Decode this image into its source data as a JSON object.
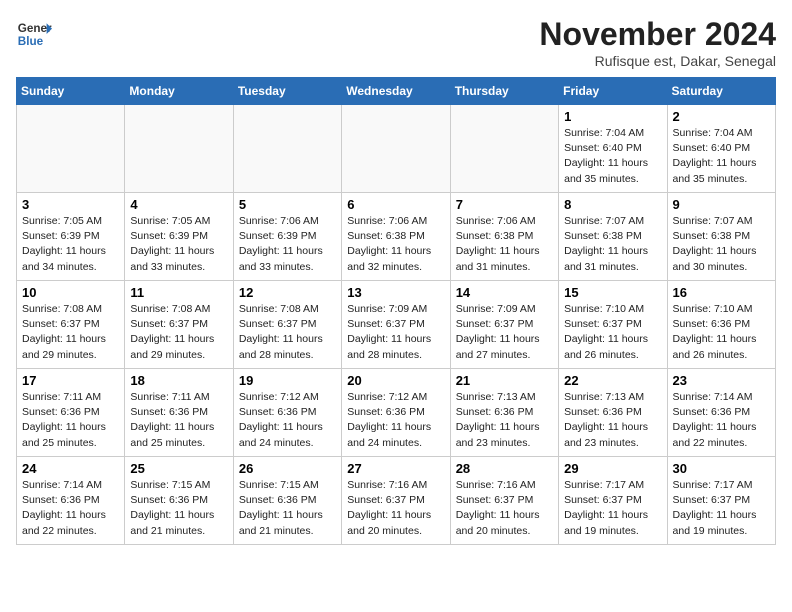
{
  "header": {
    "logo_line1": "General",
    "logo_line2": "Blue",
    "month_title": "November 2024",
    "location": "Rufisque est, Dakar, Senegal"
  },
  "weekdays": [
    "Sunday",
    "Monday",
    "Tuesday",
    "Wednesday",
    "Thursday",
    "Friday",
    "Saturday"
  ],
  "weeks": [
    [
      {
        "day": "",
        "info": ""
      },
      {
        "day": "",
        "info": ""
      },
      {
        "day": "",
        "info": ""
      },
      {
        "day": "",
        "info": ""
      },
      {
        "day": "",
        "info": ""
      },
      {
        "day": "1",
        "info": "Sunrise: 7:04 AM\nSunset: 6:40 PM\nDaylight: 11 hours\nand 35 minutes."
      },
      {
        "day": "2",
        "info": "Sunrise: 7:04 AM\nSunset: 6:40 PM\nDaylight: 11 hours\nand 35 minutes."
      }
    ],
    [
      {
        "day": "3",
        "info": "Sunrise: 7:05 AM\nSunset: 6:39 PM\nDaylight: 11 hours\nand 34 minutes."
      },
      {
        "day": "4",
        "info": "Sunrise: 7:05 AM\nSunset: 6:39 PM\nDaylight: 11 hours\nand 33 minutes."
      },
      {
        "day": "5",
        "info": "Sunrise: 7:06 AM\nSunset: 6:39 PM\nDaylight: 11 hours\nand 33 minutes."
      },
      {
        "day": "6",
        "info": "Sunrise: 7:06 AM\nSunset: 6:38 PM\nDaylight: 11 hours\nand 32 minutes."
      },
      {
        "day": "7",
        "info": "Sunrise: 7:06 AM\nSunset: 6:38 PM\nDaylight: 11 hours\nand 31 minutes."
      },
      {
        "day": "8",
        "info": "Sunrise: 7:07 AM\nSunset: 6:38 PM\nDaylight: 11 hours\nand 31 minutes."
      },
      {
        "day": "9",
        "info": "Sunrise: 7:07 AM\nSunset: 6:38 PM\nDaylight: 11 hours\nand 30 minutes."
      }
    ],
    [
      {
        "day": "10",
        "info": "Sunrise: 7:08 AM\nSunset: 6:37 PM\nDaylight: 11 hours\nand 29 minutes."
      },
      {
        "day": "11",
        "info": "Sunrise: 7:08 AM\nSunset: 6:37 PM\nDaylight: 11 hours\nand 29 minutes."
      },
      {
        "day": "12",
        "info": "Sunrise: 7:08 AM\nSunset: 6:37 PM\nDaylight: 11 hours\nand 28 minutes."
      },
      {
        "day": "13",
        "info": "Sunrise: 7:09 AM\nSunset: 6:37 PM\nDaylight: 11 hours\nand 28 minutes."
      },
      {
        "day": "14",
        "info": "Sunrise: 7:09 AM\nSunset: 6:37 PM\nDaylight: 11 hours\nand 27 minutes."
      },
      {
        "day": "15",
        "info": "Sunrise: 7:10 AM\nSunset: 6:37 PM\nDaylight: 11 hours\nand 26 minutes."
      },
      {
        "day": "16",
        "info": "Sunrise: 7:10 AM\nSunset: 6:36 PM\nDaylight: 11 hours\nand 26 minutes."
      }
    ],
    [
      {
        "day": "17",
        "info": "Sunrise: 7:11 AM\nSunset: 6:36 PM\nDaylight: 11 hours\nand 25 minutes."
      },
      {
        "day": "18",
        "info": "Sunrise: 7:11 AM\nSunset: 6:36 PM\nDaylight: 11 hours\nand 25 minutes."
      },
      {
        "day": "19",
        "info": "Sunrise: 7:12 AM\nSunset: 6:36 PM\nDaylight: 11 hours\nand 24 minutes."
      },
      {
        "day": "20",
        "info": "Sunrise: 7:12 AM\nSunset: 6:36 PM\nDaylight: 11 hours\nand 24 minutes."
      },
      {
        "day": "21",
        "info": "Sunrise: 7:13 AM\nSunset: 6:36 PM\nDaylight: 11 hours\nand 23 minutes."
      },
      {
        "day": "22",
        "info": "Sunrise: 7:13 AM\nSunset: 6:36 PM\nDaylight: 11 hours\nand 23 minutes."
      },
      {
        "day": "23",
        "info": "Sunrise: 7:14 AM\nSunset: 6:36 PM\nDaylight: 11 hours\nand 22 minutes."
      }
    ],
    [
      {
        "day": "24",
        "info": "Sunrise: 7:14 AM\nSunset: 6:36 PM\nDaylight: 11 hours\nand 22 minutes."
      },
      {
        "day": "25",
        "info": "Sunrise: 7:15 AM\nSunset: 6:36 PM\nDaylight: 11 hours\nand 21 minutes."
      },
      {
        "day": "26",
        "info": "Sunrise: 7:15 AM\nSunset: 6:36 PM\nDaylight: 11 hours\nand 21 minutes."
      },
      {
        "day": "27",
        "info": "Sunrise: 7:16 AM\nSunset: 6:37 PM\nDaylight: 11 hours\nand 20 minutes."
      },
      {
        "day": "28",
        "info": "Sunrise: 7:16 AM\nSunset: 6:37 PM\nDaylight: 11 hours\nand 20 minutes."
      },
      {
        "day": "29",
        "info": "Sunrise: 7:17 AM\nSunset: 6:37 PM\nDaylight: 11 hours\nand 19 minutes."
      },
      {
        "day": "30",
        "info": "Sunrise: 7:17 AM\nSunset: 6:37 PM\nDaylight: 11 hours\nand 19 minutes."
      }
    ]
  ]
}
